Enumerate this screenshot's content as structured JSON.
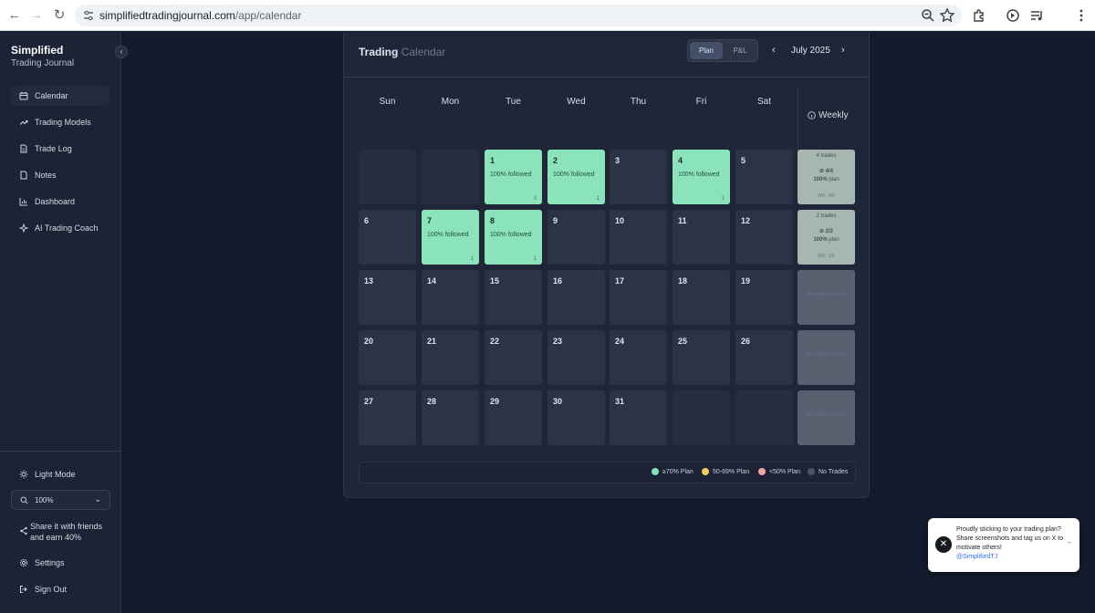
{
  "browser": {
    "url_host": "simplifiedtradingjournal.com",
    "url_path": "/app/calendar"
  },
  "sidebar": {
    "brand_line1": "Simplified",
    "brand_line2": "Trading Journal",
    "collapse_glyph": "‹",
    "items": [
      {
        "label": "Calendar",
        "icon": "calendar-icon"
      },
      {
        "label": "Trading Models",
        "icon": "trend-icon"
      },
      {
        "label": "Trade Log",
        "icon": "document-icon"
      },
      {
        "label": "Notes",
        "icon": "note-icon"
      },
      {
        "label": "Dashboard",
        "icon": "chart-icon"
      },
      {
        "label": "AI Trading Coach",
        "icon": "sparkle-icon"
      }
    ],
    "light_mode": "Light Mode",
    "zoom": "100%",
    "share": "Share it with friends and earn 40%",
    "settings": "Settings",
    "sign_out": "Sign Out"
  },
  "calendar": {
    "title_main": "Trading",
    "title_muted": "Calendar",
    "toggle": {
      "plan": "Plan",
      "pnl": "P&L"
    },
    "month": "July 2025",
    "prev_glyph": "‹",
    "next_glyph": "›",
    "day_headers": [
      "Sun",
      "Mon",
      "Tue",
      "Wed",
      "Thu",
      "Fri",
      "Sat"
    ],
    "weekly_header": "Weekly",
    "weeks": [
      {
        "days": [
          {
            "day": ""
          },
          {
            "day": ""
          },
          {
            "day": "1",
            "status": "100% followed",
            "count": "3"
          },
          {
            "day": "2",
            "status": "100% followed",
            "count": "1"
          },
          {
            "day": "3"
          },
          {
            "day": "4",
            "status": "100% followed",
            "count": "1"
          },
          {
            "day": "5"
          }
        ],
        "weekly": {
          "trades": "4 trades",
          "ratio": "4/4",
          "plan_pct": "100%",
          "plan_word": "plan",
          "wl": "W/L: 4/0"
        }
      },
      {
        "days": [
          {
            "day": "6"
          },
          {
            "day": "7",
            "status": "100% followed",
            "count": "1"
          },
          {
            "day": "8",
            "status": "100% followed",
            "count": "1"
          },
          {
            "day": "9"
          },
          {
            "day": "10"
          },
          {
            "day": "11"
          },
          {
            "day": "12"
          }
        ],
        "weekly": {
          "trades": "2 trades",
          "ratio": "2/2",
          "plan_pct": "100%",
          "plan_word": "plan",
          "wl": "W/L: 2/0"
        }
      },
      {
        "days": [
          {
            "day": "13"
          },
          {
            "day": "14"
          },
          {
            "day": "15"
          },
          {
            "day": "16"
          },
          {
            "day": "17"
          },
          {
            "day": "18"
          },
          {
            "day": "19"
          }
        ],
        "weekly": {
          "none": "No trades this week"
        }
      },
      {
        "days": [
          {
            "day": "20"
          },
          {
            "day": "21"
          },
          {
            "day": "22"
          },
          {
            "day": "23"
          },
          {
            "day": "24"
          },
          {
            "day": "25"
          },
          {
            "day": "26"
          }
        ],
        "weekly": {
          "none": "No trades this week"
        }
      },
      {
        "days": [
          {
            "day": "27"
          },
          {
            "day": "28"
          },
          {
            "day": "29"
          },
          {
            "day": "30"
          },
          {
            "day": "31"
          },
          {
            "day": ""
          },
          {
            "day": ""
          }
        ],
        "weekly": {
          "none": "No trades this week"
        }
      }
    ],
    "legend": [
      {
        "label": "≥70% Plan",
        "color": "#7fe3b6"
      },
      {
        "label": "50-69% Plan",
        "color": "#f2cf5b"
      },
      {
        "label": "<50% Plan",
        "color": "#f3a3a0"
      },
      {
        "label": "No Trades",
        "color": "#4b5567"
      }
    ]
  },
  "toast": {
    "message": "Proudly sticking to your trading plan? Share screenshots and tag us on X to motivate others!",
    "handle": "@SimplifiedTJ",
    "close_glyph": "✕",
    "minimize_glyph": "–"
  },
  "colors": {
    "background": "#131b2c",
    "panel": "#1f2638",
    "cell": "#2b3346",
    "followed": "#8be3bb",
    "weekly_summary": "#a6b6b1"
  }
}
